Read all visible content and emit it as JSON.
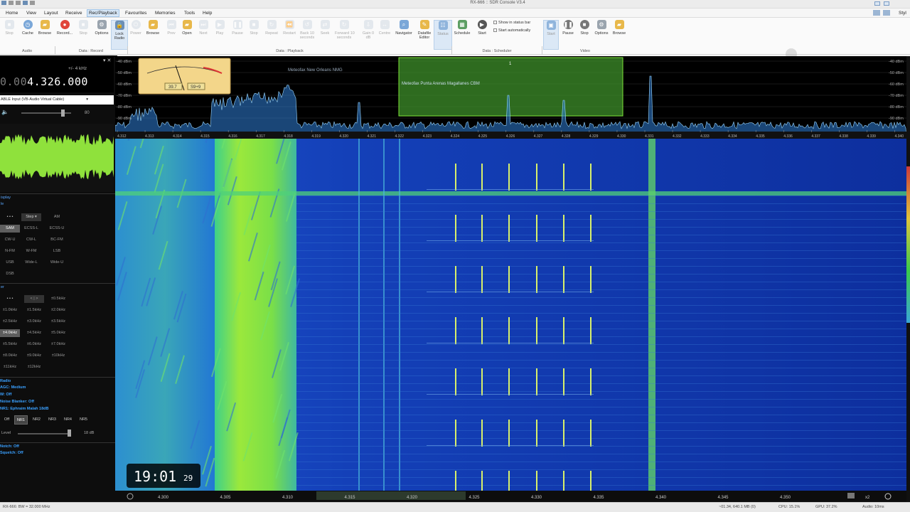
{
  "window": {
    "title": "RX-666 :: SDR Console V3.4"
  },
  "menu": [
    "Home",
    "View",
    "Layout",
    "Receive",
    "Rec/Playback",
    "Favourites",
    "Memories",
    "Tools",
    "Help"
  ],
  "menu_active": "Rec/Playback",
  "menu_right": "Styl",
  "ribbon": {
    "audio": {
      "group": "Audio",
      "buttons": [
        "Stop",
        "Cache",
        "Browse"
      ]
    },
    "data_record": {
      "group": "Data : Record",
      "buttons": [
        "Record...",
        "Stop",
        "Options"
      ]
    },
    "lock_radio": "Lock\nRadio",
    "power": "Power",
    "browse": "Browse",
    "playback": {
      "group": "Data : Playback",
      "buttons": [
        "Prev",
        "Open",
        "Next",
        "Play",
        "Pause",
        "Stop",
        "Repeat",
        "Restart"
      ],
      "back10": "Back 10\nseconds",
      "seek": "Seek",
      "forward10": "Forward 10\nseconds",
      "gain": "Gain 0\ndB",
      "centre": "Centre",
      "navigator": "Navigator",
      "datafile_editor": "Datafile\nEditor",
      "status": "Status"
    },
    "scheduler": {
      "group": "Data : Scheduler",
      "buttons": [
        "Schedule",
        "Start"
      ],
      "show_status": "Show in status bar",
      "start_auto": "Start automatically"
    },
    "video": {
      "group": "Video",
      "buttons": [
        "Start",
        "Pause",
        "Stop",
        "Options",
        "Browse"
      ]
    }
  },
  "left": {
    "bandwidth": "+/- 4 kHz",
    "freq_dim": "0.00",
    "freq_main": "4.326.000",
    "input": "ABLE Input (VB-Audio Virtual Cable)",
    "volume": "80",
    "display_section": "isplay",
    "display_sub": "le",
    "modes": {
      "step": "Step",
      "row1": [
        "AM"
      ],
      "row2": [
        "SAM",
        "ECSS-L",
        "ECSS-U"
      ],
      "row3": [
        "CW-U",
        "CW-L",
        "BC-FM"
      ],
      "row4": [
        "N-FM",
        "W-FM",
        "LSB"
      ],
      "row5": [
        "USB",
        "Wide-L",
        "Wide-U"
      ],
      "row6": [
        "DSB"
      ]
    },
    "active_mode": "SAM",
    "filter_section": "er",
    "filters": {
      "row0": [
        "< | >",
        "±0.5kHz"
      ],
      "row1": [
        "±1.0kHz",
        "±1.5kHz",
        "±2.0kHz"
      ],
      "row2": [
        "±2.5kHz",
        "±3.0kHz",
        "±3.5kHz"
      ],
      "row3": [
        "±4.0kHz",
        "±4.5kHz",
        "±5.0kHz"
      ],
      "row4": [
        "±5.5kHz",
        "±6.0kHz",
        "±7.0kHz"
      ],
      "row5": [
        "±8.0kHz",
        "±9.0kHz",
        "±10kHz"
      ],
      "row6": [
        "±11kHz",
        "±12kHz"
      ]
    },
    "active_filter": "±4.0kHz",
    "radio_status": {
      "title": "Radio",
      "agc": "AGC: Medium",
      "w": "W: Off",
      "noise": "Noise Blanker: Off",
      "nr": "NR1: Ephraim Malah 18dB"
    },
    "nr_buttons": [
      "Off",
      "NR1",
      "NR2",
      "NR3",
      "NR4",
      "NR5"
    ],
    "nr_active": "NR1",
    "level_label": "Level",
    "level_value": "18 dB",
    "notch": "Notch: Off",
    "squelch": "Squelch: Off"
  },
  "spectrum": {
    "dbm_labels": [
      "-40 dBm",
      "-50 dBm",
      "-60 dBm",
      "-70 dBm",
      "-80 dBm",
      "-90 dBm"
    ],
    "dbm_right": [
      "-40 dBm",
      "-50 dBm",
      "-60 dBm",
      "-70 dBm",
      "-80 dBm",
      "-90 dBm"
    ],
    "meter": {
      "value": "39.7",
      "s": "S9+9"
    },
    "marker1": "Meteofax New Orleans NMG",
    "marker2": "Meteofax Punta Arenas Magallanes CBM",
    "marker2_num": "1",
    "freq_labels": [
      "4.312",
      "4.313",
      "4.314",
      "4.315",
      "4.316",
      "4.317",
      "4.318",
      "4.319",
      "4.320",
      "4.321",
      "4.322",
      "4.323",
      "4.324",
      "4.325",
      "4.326",
      "4.327",
      "4.328",
      "4.329",
      "4.330",
      "4.331",
      "4.332",
      "4.333",
      "4.334",
      "4.335",
      "4.336",
      "4.337",
      "4.338",
      "4.339",
      "4.340"
    ]
  },
  "waterfall": {
    "clock_hm": "19:01",
    "clock_ss": "29",
    "scale": [
      "4.300",
      "4.305",
      "4.310",
      "4.315",
      "4.320",
      "4.325",
      "4.330",
      "4.335",
      "4.340",
      "4.345",
      "4.350"
    ]
  },
  "statusbar": {
    "left": "RX-666: BW = 32.000 MHz",
    "stats": "~01.34, 640.1 MB (0)",
    "cpu": "CPU: 15.1%",
    "gpu": "GPU: 37.2%",
    "audio": "Audio: 10ms"
  },
  "colors": {
    "accent": "#3aa0ff",
    "waterfall_bg": "#1034a8",
    "signal": "#7ee63a"
  }
}
